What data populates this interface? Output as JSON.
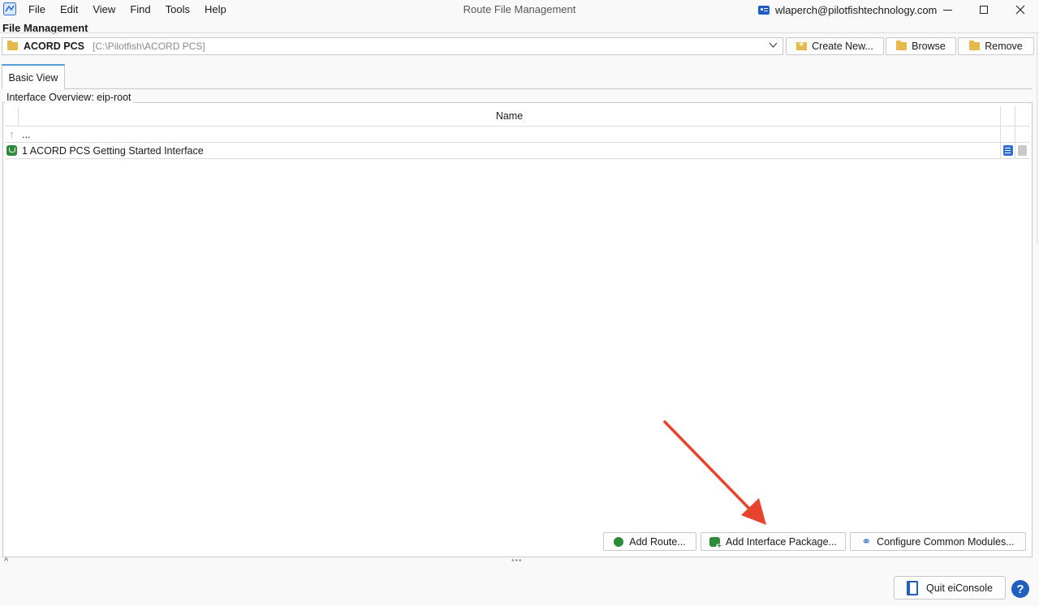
{
  "window": {
    "title": "Route File Management",
    "user": "wlaperch@pilotfishtechnology.com",
    "menu": [
      "File",
      "Edit",
      "View",
      "Find",
      "Tools",
      "Help"
    ],
    "icons": {
      "app": "app-icon",
      "user": "user-card-icon"
    }
  },
  "file_management": {
    "label": "File Management",
    "selected_name": "ACORD PCS",
    "selected_path": "[C:\\Pilotfish\\ACORD PCS]",
    "buttons": {
      "create": "Create New...",
      "browse": "Browse",
      "remove": "Remove"
    }
  },
  "tabs": [
    {
      "label": "Basic View",
      "active": true
    }
  ],
  "overview": {
    "title": "Interface Overview: eip-root",
    "column_name": "Name",
    "rows": [
      {
        "icon": "up-arrow-icon",
        "name": "..."
      },
      {
        "icon": "package-icon",
        "name": "1 ACORD PCS Getting Started Interface"
      }
    ]
  },
  "actions": {
    "add_route": "Add Route...",
    "add_package": "Add Interface Package...",
    "configure_modules": "Configure Common Modules..."
  },
  "footer": {
    "quit": "Quit eiConsole",
    "help": "?"
  },
  "colors": {
    "accent": "#1f5fbf",
    "tab_indicator": "#5b9bd5",
    "folder": "#e6b94a",
    "green": "#2e8b3a",
    "annotation_arrow": "#e8432e"
  }
}
